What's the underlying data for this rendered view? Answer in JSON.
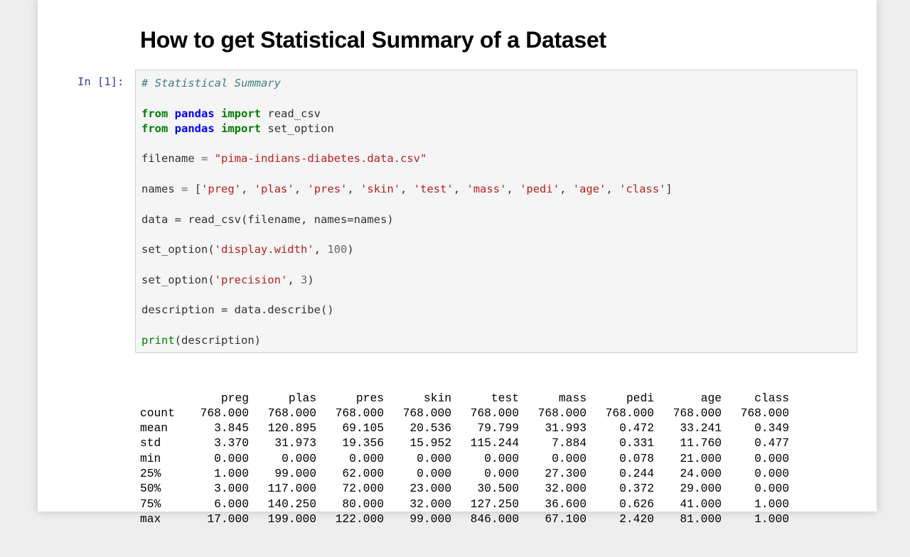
{
  "notebook": {
    "heading": "How to get Statistical Summary of a Dataset",
    "cell": {
      "prompt": "In [1]:",
      "code": {
        "comment": "# Statistical Summary",
        "import1": {
          "from": "from",
          "module": "pandas",
          "import": "import",
          "name": "read_csv"
        },
        "import2": {
          "from": "from",
          "module": "pandas",
          "import": "import",
          "name": "set_option"
        },
        "filename_var": "filename",
        "filename_value": "\"pima-indians-diabetes.data.csv\"",
        "names_var": "names",
        "names_list": [
          "'preg'",
          "'plas'",
          "'pres'",
          "'skin'",
          "'test'",
          "'mass'",
          "'pedi'",
          "'age'",
          "'class'"
        ],
        "data_line": "data = read_csv(filename, names=names)",
        "set_option1": {
          "func": "set_option(",
          "arg": "'display.width'",
          "num": "100"
        },
        "set_option2": {
          "func": "set_option(",
          "arg": "'precision'",
          "num": "3"
        },
        "describe_line": "description = data.describe()",
        "print_func": "print",
        "print_arg": "(description)"
      }
    },
    "output": {
      "columns": [
        "preg",
        "plas",
        "pres",
        "skin",
        "test",
        "mass",
        "pedi",
        "age",
        "class"
      ],
      "rows": [
        {
          "label": "count",
          "values": [
            "768.000",
            "768.000",
            "768.000",
            "768.000",
            "768.000",
            "768.000",
            "768.000",
            "768.000",
            "768.000"
          ]
        },
        {
          "label": "mean",
          "values": [
            "3.845",
            "120.895",
            "69.105",
            "20.536",
            "79.799",
            "31.993",
            "0.472",
            "33.241",
            "0.349"
          ]
        },
        {
          "label": "std",
          "values": [
            "3.370",
            "31.973",
            "19.356",
            "15.952",
            "115.244",
            "7.884",
            "0.331",
            "11.760",
            "0.477"
          ]
        },
        {
          "label": "min",
          "values": [
            "0.000",
            "0.000",
            "0.000",
            "0.000",
            "0.000",
            "0.000",
            "0.078",
            "21.000",
            "0.000"
          ]
        },
        {
          "label": "25%",
          "values": [
            "1.000",
            "99.000",
            "62.000",
            "0.000",
            "0.000",
            "27.300",
            "0.244",
            "24.000",
            "0.000"
          ]
        },
        {
          "label": "50%",
          "values": [
            "3.000",
            "117.000",
            "72.000",
            "23.000",
            "30.500",
            "32.000",
            "0.372",
            "29.000",
            "0.000"
          ]
        },
        {
          "label": "75%",
          "values": [
            "6.000",
            "140.250",
            "80.000",
            "32.000",
            "127.250",
            "36.600",
            "0.626",
            "41.000",
            "1.000"
          ]
        },
        {
          "label": "max",
          "values": [
            "17.000",
            "199.000",
            "122.000",
            "99.000",
            "846.000",
            "67.100",
            "2.420",
            "81.000",
            "1.000"
          ]
        }
      ]
    }
  }
}
